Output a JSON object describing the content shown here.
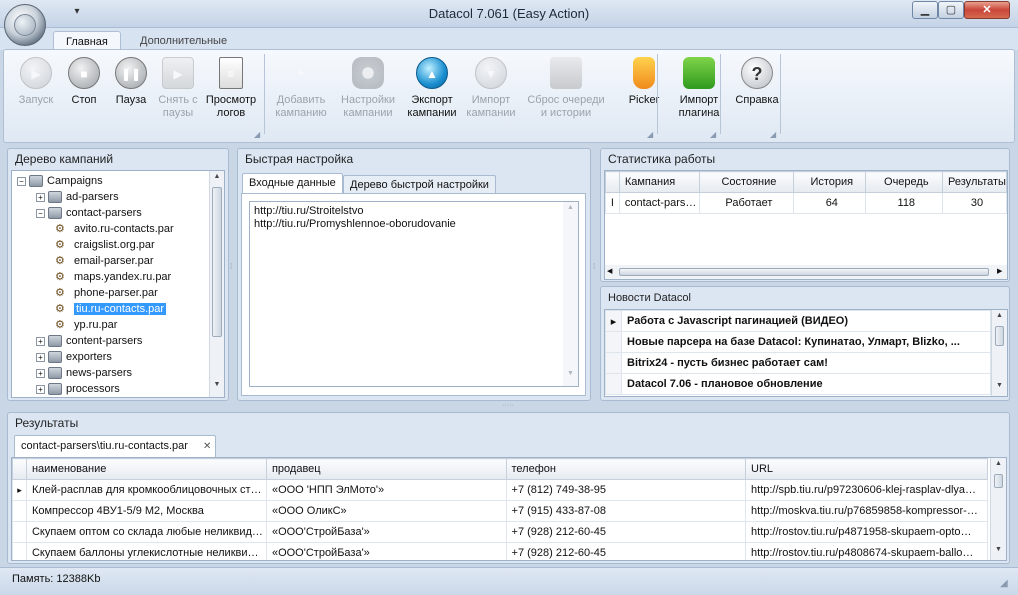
{
  "window": {
    "title": "Datacol 7.061 (Easy Action)",
    "minimize": "▁",
    "maximize": "▢",
    "close": "✕"
  },
  "ribbon": {
    "tabs": [
      "Главная",
      "Дополнительные"
    ],
    "buttons": [
      {
        "l1": "Запуск",
        "l2": "",
        "icon": "play-icon",
        "enabled": false
      },
      {
        "l1": "Стоп",
        "l2": "",
        "icon": "stop-icon",
        "enabled": true
      },
      {
        "l1": "Пауза",
        "l2": "",
        "icon": "pause-icon",
        "enabled": true
      },
      {
        "l1": "Снять с",
        "l2": "паузы",
        "icon": "resume-icon",
        "enabled": false
      },
      {
        "l1": "Просмотр",
        "l2": "логов",
        "icon": "log-icon",
        "enabled": true
      },
      {
        "l1": "Добавить",
        "l2": "кампанию",
        "icon": "wand-icon",
        "enabled": false
      },
      {
        "l1": "Настройки",
        "l2": "кампании",
        "icon": "gear-icon",
        "enabled": false
      },
      {
        "l1": "Экспорт",
        "l2": "кампании",
        "icon": "export-icon",
        "enabled": true
      },
      {
        "l1": "Импорт",
        "l2": "кампании",
        "icon": "import-icon",
        "enabled": false
      },
      {
        "l1": "Сброс очереди",
        "l2": "и истории",
        "icon": "reset-icon",
        "enabled": false
      },
      {
        "l1": "Picker",
        "l2": "",
        "icon": "picker-hand-icon",
        "enabled": true
      },
      {
        "l1": "Импорт",
        "l2": "плагина",
        "icon": "puzzle-icon",
        "enabled": true
      },
      {
        "l1": "Справка",
        "l2": "",
        "icon": "help-icon",
        "enabled": true
      }
    ]
  },
  "campaign_tree": {
    "header": "Дерево кампаний",
    "rows": [
      {
        "label": "Campaigns",
        "kind": "folder",
        "exp": "−",
        "selected": false
      },
      {
        "label": "ad-parsers",
        "kind": "folder",
        "exp": "+",
        "selected": false
      },
      {
        "label": "contact-parsers",
        "kind": "folder",
        "exp": "−",
        "selected": false
      },
      {
        "label": "avito.ru-contacts.par",
        "kind": "par",
        "exp": "",
        "selected": false
      },
      {
        "label": "craigslist.org.par",
        "kind": "par",
        "exp": "",
        "selected": false
      },
      {
        "label": "email-parser.par",
        "kind": "par",
        "exp": "",
        "selected": false
      },
      {
        "label": "maps.yandex.ru.par",
        "kind": "par",
        "exp": "",
        "selected": false
      },
      {
        "label": "phone-parser.par",
        "kind": "par",
        "exp": "",
        "selected": false
      },
      {
        "label": "tiu.ru-contacts.par",
        "kind": "par",
        "exp": "",
        "selected": true
      },
      {
        "label": "yp.ru.par",
        "kind": "par",
        "exp": "",
        "selected": false
      },
      {
        "label": "content-parsers",
        "kind": "folder",
        "exp": "+",
        "selected": false
      },
      {
        "label": "exporters",
        "kind": "folder",
        "exp": "+",
        "selected": false
      },
      {
        "label": "news-parsers",
        "kind": "folder",
        "exp": "+",
        "selected": false
      },
      {
        "label": "processors",
        "kind": "folder",
        "exp": "+",
        "selected": false
      }
    ]
  },
  "quick_settings": {
    "header": "Быстрая настройка",
    "tabs": [
      "Входные данные",
      "Дерево быстрой настройки"
    ],
    "input_lines": [
      "http://tiu.ru/Stroitelstvo",
      "http://tiu.ru/Promyshlennoe-oborudovanie"
    ]
  },
  "stats": {
    "header": "Статистика работы",
    "columns": [
      "Кампания",
      "Состояние",
      "История",
      "Очередь",
      "Результаты"
    ],
    "rows": [
      {
        "marker": "I",
        "cells": [
          "contact-pars…",
          "Работает",
          "64",
          "118",
          "30"
        ]
      }
    ]
  },
  "news": {
    "header": "Новости Datacol",
    "items": [
      "Работа с Javascript пагинацией (ВИДЕО)",
      "Новые парсера на базе Datacol: Купинатао, Улмарт, Blizko, ...",
      "Bitrix24 - пусть бизнес работает сам!",
      "Datacol 7.06 - плановое обновление"
    ]
  },
  "results": {
    "header": "Результаты",
    "tab_label": "contact-parsers\\tiu.ru-contacts.par",
    "tab_close": "✕",
    "columns": [
      "наименование",
      "продавец",
      "телефон",
      "URL"
    ],
    "rows": [
      {
        "marker": "▸",
        "cells": [
          "Клей-расплав для кромкооблицовочных ст…",
          "«ООО 'НПП ЭлМото'»",
          "+7 (812) 749-38-95",
          "http://spb.tiu.ru/p97230606-klej-rasplav-dlya…"
        ]
      },
      {
        "marker": "",
        "cells": [
          "Компрессор 4ВУ1-5/9 М2, Москва",
          "«ООО ОликС»",
          "+7 (915) 433-87-08",
          "http://moskva.tiu.ru/p76859858-kompressor-…"
        ]
      },
      {
        "marker": "",
        "cells": [
          "Скупаем оптом со склада любые неликвид…",
          "«ООО'СтройБаза'»",
          "+7 (928) 212-60-45",
          "http://rostov.tiu.ru/p4871958-skupaem-opto…"
        ]
      },
      {
        "marker": "",
        "cells": [
          "Скупаем баллоны углекислотные неликви…",
          "«ООО'СтройБаза'»",
          "+7 (928) 212-60-45",
          "http://rostov.tiu.ru/p4808674-skupaem-ballo…"
        ]
      }
    ]
  },
  "statusbar": {
    "memory": "Память: 12388Kb"
  }
}
